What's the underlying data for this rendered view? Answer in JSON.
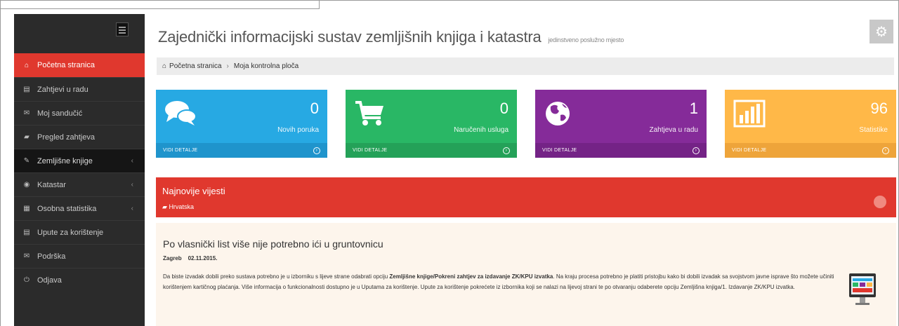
{
  "app": {
    "title": "Zajednički informacijski sustav zemljišnih knjiga i katastra",
    "subtitle": "jedinstveno poslužno mjesto"
  },
  "sidebar": {
    "items": [
      {
        "label": "Početna stranica",
        "icon": "home-icon",
        "glyph": "⌂"
      },
      {
        "label": "Zahtjevi u radu",
        "icon": "list-icon",
        "glyph": "▤"
      },
      {
        "label": "Moj sandučić",
        "icon": "envelope-icon",
        "glyph": "✉"
      },
      {
        "label": "Pregled zahtjeva",
        "icon": "folder-icon",
        "glyph": "▰"
      },
      {
        "label": "Zemljišne knjige",
        "icon": "tools-icon",
        "glyph": "✎"
      },
      {
        "label": "Katastar",
        "icon": "globe-icon",
        "glyph": "◉"
      },
      {
        "label": "Osobna statistika",
        "icon": "chart-icon",
        "glyph": "▦"
      },
      {
        "label": "Upute za korištenje",
        "icon": "document-icon",
        "glyph": "▤"
      },
      {
        "label": "Podrška",
        "icon": "envelope-icon",
        "glyph": "✉"
      },
      {
        "label": "Odjava",
        "icon": "power-icon",
        "glyph": "⏻"
      }
    ]
  },
  "breadcrumb": {
    "home": "Početna stranica",
    "current": "Moja kontrolna ploča"
  },
  "tiles": [
    {
      "count": "0",
      "label": "Novih poruka",
      "footer": "VIDI DETALJE",
      "color": "#27a9e3",
      "icon": "chat-icon"
    },
    {
      "count": "0",
      "label": "Naručenih usluga",
      "footer": "VIDI DETALJE",
      "color": "#29b765",
      "icon": "cart-icon"
    },
    {
      "count": "1",
      "label": "Zahtjeva u radu",
      "footer": "VIDI DETALJE",
      "color": "#852b99",
      "icon": "globe-icon"
    },
    {
      "count": "96",
      "label": "Statistike",
      "footer": "VIDI DETALJE",
      "color": "#ffb848",
      "icon": "bar-chart-icon"
    }
  ],
  "news": {
    "heading": "Najnovije vijesti",
    "tag": "Hrvatska",
    "article": {
      "title": "Po vlasnički list više nije potrebno ići u gruntovnicu",
      "location": "Zagreb",
      "date": "02.11.2015.",
      "text_1": "Da biste izvadak dobili preko sustava potrebno je u izborniku s lijeve strane odabrati opciju ",
      "text_bold": "Zemljišne knjige/Pokreni zahtjev za izdavanje ZK/KPU izvatka",
      "text_2": ". Na kraju procesa potrebno je platiti pristojbu kako bi dobili izvadak sa svojstvom javne isprave što možete učiniti korištenjem kartičnog plaćanja. Više informacija o funkcionalnosti dostupno je u Uputama za korištenje. Upute za korištenje pokrećete iz izbornika koji se nalazi na lijevoj strani te po otvaranju odaberete opciju Zemljišna knjiga/1. Izdavanje ZK/KPU izvatka."
    }
  }
}
